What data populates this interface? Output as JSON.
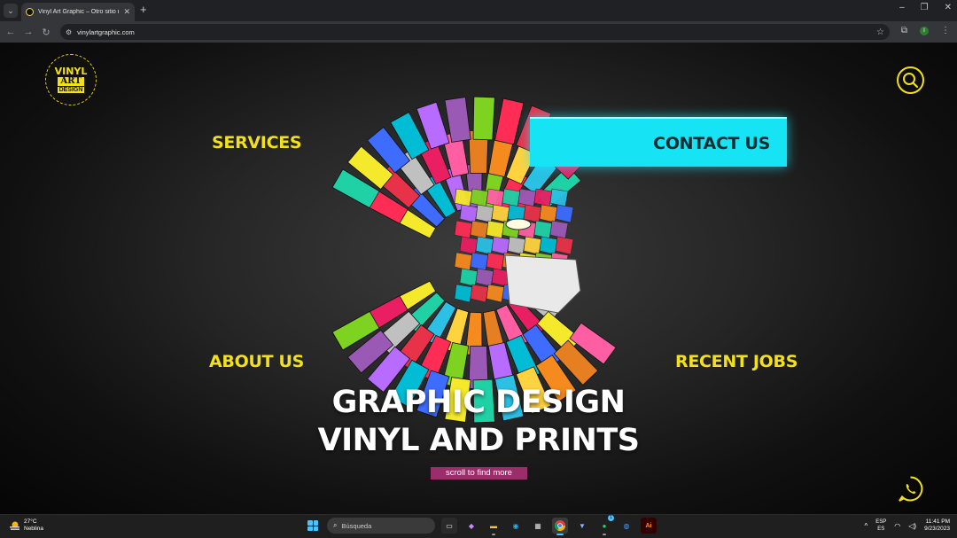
{
  "browser": {
    "tab_title": "Vinyl Art Graphic – Otro sitio realizado",
    "url": "vinylartgraphic.com",
    "icons": [
      "tab-search-icon",
      "close-icon",
      "new-tab-icon",
      "back-icon",
      "forward-icon",
      "reload-icon",
      "site-info-icon",
      "star-icon",
      "extensions-icon",
      "menu-icon"
    ],
    "profile_initial": "I",
    "window_controls": [
      "minimize",
      "restore",
      "close"
    ]
  },
  "site": {
    "logo": {
      "line1": "VINYL",
      "line2": "ART",
      "line3": "DESIGN"
    },
    "nav": {
      "services": "SERVICES",
      "contact": "CONTACT US",
      "about": "ABOUT US",
      "recent": "RECENT JOBS"
    },
    "hero": {
      "line1": "GRAPHIC DESIGN",
      "line2": "VINYL AND PRINTS",
      "scroll": "scroll to find more"
    },
    "colors": {
      "accent_yellow": "#f2e01c",
      "contact_cyan": "#16e3f3",
      "pill_magenta": "#9c2d6b"
    }
  },
  "taskbar": {
    "weather_temp": "27°C",
    "weather_desc": "Neblina",
    "search_placeholder": "Búsqueda",
    "lang_top": "ESP",
    "lang_bottom": "ES",
    "time": "11:41 PM",
    "date": "9/23/2023",
    "notification_badge": "1"
  }
}
